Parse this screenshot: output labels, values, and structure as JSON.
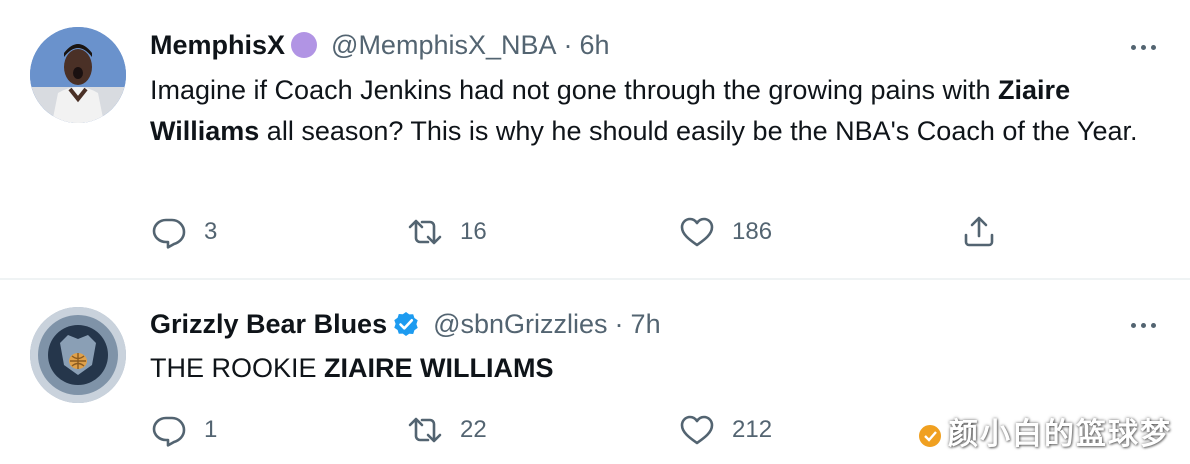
{
  "tweets": [
    {
      "author_name": "MemphisX",
      "handle": "@MemphisX_NBA",
      "separator": "·",
      "time": "6h",
      "text_plain_1": "Imagine if Coach Jenkins had not gone through the growing pains with ",
      "text_bold_1": "Ziaire Williams",
      "text_plain_2": " all season?  This is why he should easily be the NBA's Coach of the Year.",
      "replies": "3",
      "retweets": "16",
      "likes": "186",
      "badge_color": "#b194e4"
    },
    {
      "author_name": "Grizzly Bear Blues",
      "handle": "@sbnGrizzlies",
      "separator": "·",
      "time": "7h",
      "text_plain_1": "THE ROOKIE ",
      "text_bold_1": "ZIAIRE WILLIAMS",
      "replies": "1",
      "retweets": "22",
      "likes": "212",
      "badge_color": "#1d9bf0"
    }
  ],
  "watermark": "颜小白的篮球梦",
  "icons": {
    "reply": "reply-icon",
    "retweet": "retweet-icon",
    "like": "heart-icon",
    "share": "share-icon",
    "more": "more-icon",
    "verified": "verified-badge-icon"
  },
  "colors": {
    "text": "#0f1419",
    "secondary": "#536471",
    "divider": "#eff3f4",
    "verified": "#1d9bf0"
  }
}
